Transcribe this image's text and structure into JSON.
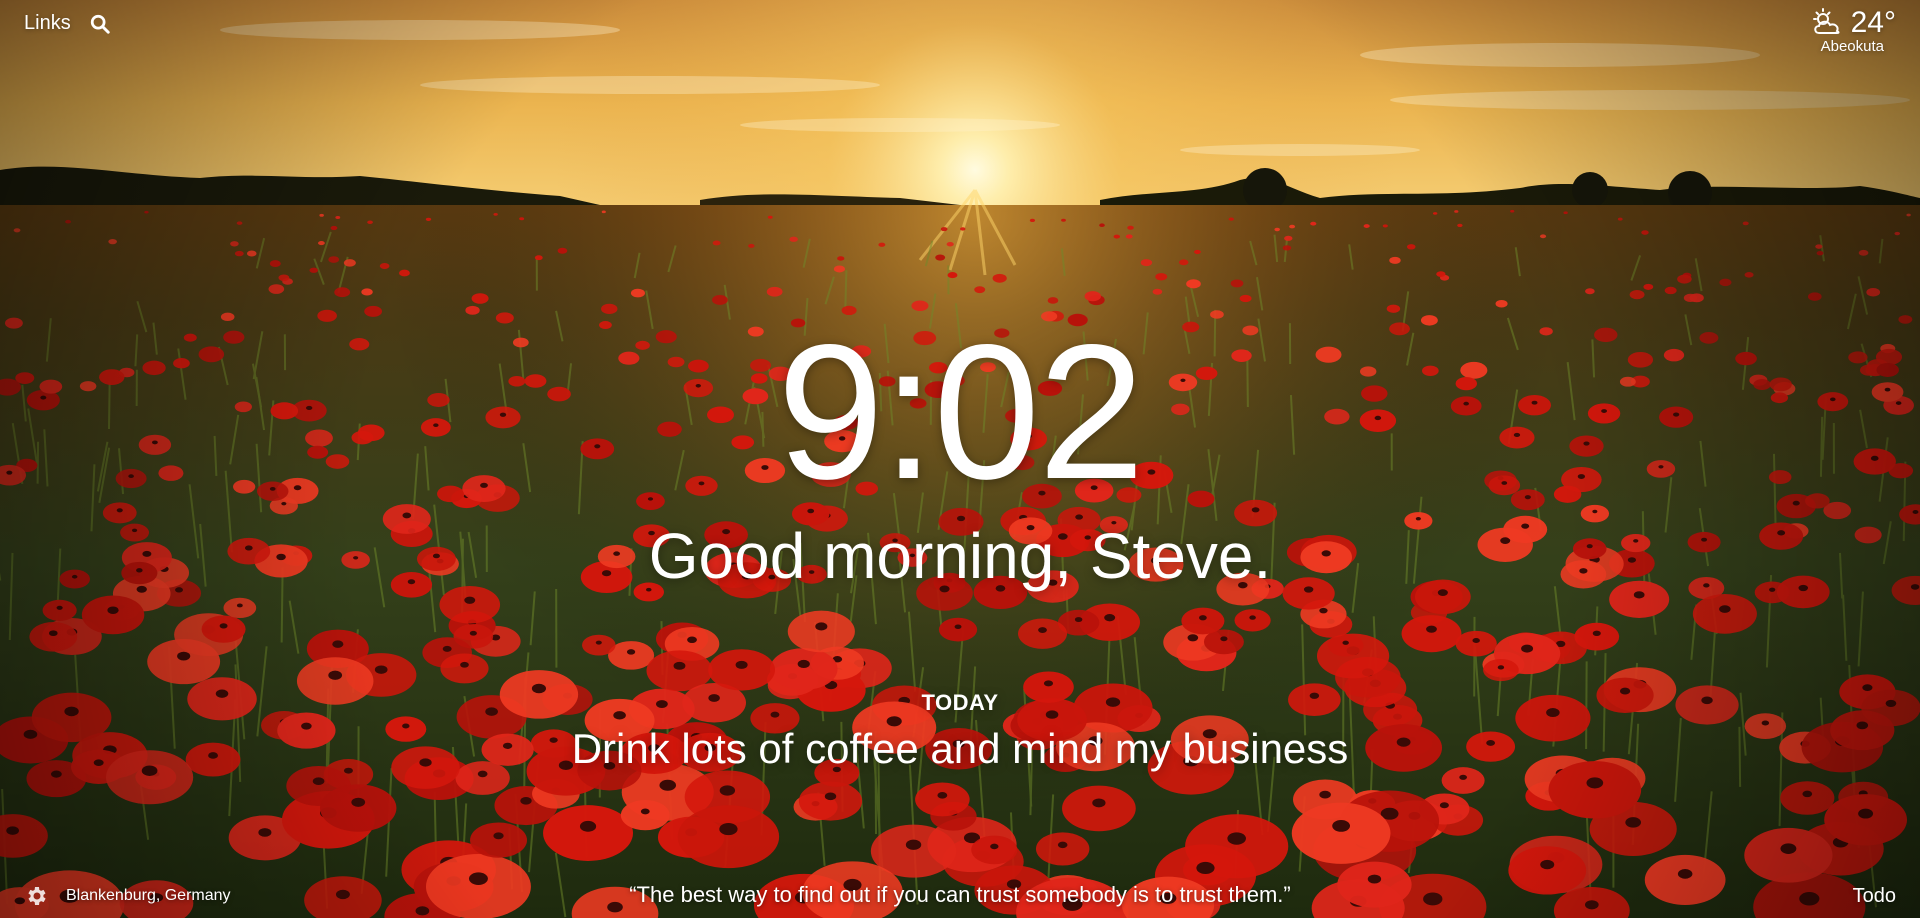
{
  "background": {
    "description_colors": {
      "sky_top": "#e9a94a",
      "sky_glow": "#fff1b8",
      "field": "#3a4a1a",
      "poppy": "#d41a0e"
    }
  },
  "nav": {
    "links_label": "Links",
    "search_icon": "search-icon"
  },
  "weather": {
    "icon": "partly-cloudy-icon",
    "temperature": "24°",
    "location": "Abeokuta"
  },
  "clock": {
    "time": "9:02"
  },
  "greeting": {
    "text": "Good morning, Steve."
  },
  "focus": {
    "label": "TODAY",
    "text": "Drink lots of coffee and mind my business"
  },
  "footer": {
    "settings_icon": "gear-icon",
    "photo_location": "Blankenburg, Germany",
    "quote": "“The best way to find out if you can trust somebody is to trust them.”",
    "todo_label": "Todo"
  }
}
